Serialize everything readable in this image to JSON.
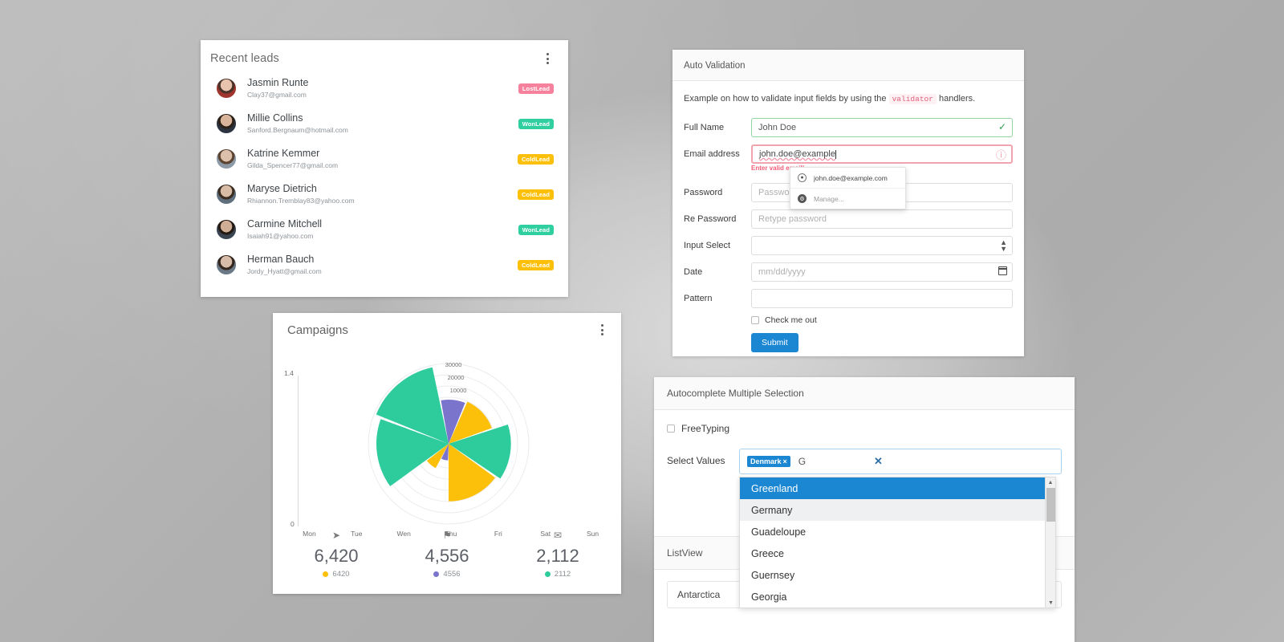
{
  "recent_leads": {
    "title": "Recent leads",
    "menu_icon": "kebab-menu-icon",
    "items": [
      {
        "name": "Jasmin Runte",
        "email": "Clay37@gmail.com",
        "badge": "LostLead",
        "badge_type": "lost"
      },
      {
        "name": "Millie Collins",
        "email": "Sanford.Bergnaum@hotmail.com",
        "badge": "WonLead",
        "badge_type": "won"
      },
      {
        "name": "Katrine Kemmer",
        "email": "Gilda_Spencer77@gmail.com",
        "badge": "ColdLead",
        "badge_type": "cold"
      },
      {
        "name": "Maryse Dietrich",
        "email": "Rhiannon.Tremblay83@yahoo.com",
        "badge": "ColdLead",
        "badge_type": "cold"
      },
      {
        "name": "Carmine Mitchell",
        "email": "Isaiah91@yahoo.com",
        "badge": "WonLead",
        "badge_type": "won"
      },
      {
        "name": "Herman Bauch",
        "email": "Jordy_Hyatt@gmail.com",
        "badge": "ColdLead",
        "badge_type": "cold"
      }
    ],
    "badge_colors": {
      "lost": "#f6819c",
      "won": "#30cfa0",
      "cold": "#fcc00a"
    }
  },
  "campaigns": {
    "title": "Campaigns",
    "menu_icon": "kebab-menu-icon",
    "stats": [
      {
        "icon": "send-icon",
        "value": "6,420",
        "legend": "6420",
        "color": "#fcc00a"
      },
      {
        "icon": "flag-icon",
        "value": "4,556",
        "legend": "4556",
        "color": "#7b74cd"
      },
      {
        "icon": "envelope-icon",
        "value": "2,112",
        "legend": "2112",
        "color": "#2ecb9c"
      }
    ]
  },
  "chart_data": {
    "type": "pie",
    "title": "Campaigns",
    "subtype": "polar-rose",
    "xlabel": "",
    "ylabel": "",
    "ylim": [
      0,
      1.4
    ],
    "y_tick_labels": [
      "1.4",
      "0"
    ],
    "x_tick_labels": [
      "Mon",
      "Tue",
      "Wen",
      "Thu",
      "Fri",
      "Sat",
      "Sun"
    ],
    "radial_tick_labels": [
      "30000",
      "20000",
      "10000"
    ],
    "radial_max": 30000,
    "grid": true,
    "legend_position": "bottom",
    "series": [
      {
        "name": "6420",
        "color": "#fcc00a",
        "values": [
          10300,
          21500,
          4200
        ]
      },
      {
        "name": "4556",
        "color": "#7b74cd",
        "values": [
          16500,
          6200
        ]
      },
      {
        "name": "2112",
        "color": "#2ecb9c",
        "values": [
          29200,
          23300
        ]
      }
    ],
    "wedges": [
      {
        "series": "2112",
        "color": "#2ecb9c",
        "start_deg": 292,
        "end_deg": 348,
        "value": 29200
      },
      {
        "series": "4556",
        "color": "#7b74cd",
        "start_deg": 350,
        "end_deg": 22,
        "value": 16500
      },
      {
        "series": "6420",
        "color": "#fcc00a",
        "start_deg": 24,
        "end_deg": 70,
        "value": 17200
      },
      {
        "series": "2112",
        "color": "#2ecb9c",
        "start_deg": 72,
        "end_deg": 124,
        "value": 23300
      },
      {
        "series": "6420",
        "color": "#fcc00a",
        "start_deg": 126,
        "end_deg": 180,
        "value": 21500
      },
      {
        "series": "4556",
        "color": "#7b74cd",
        "start_deg": 182,
        "end_deg": 206,
        "value": 6200
      },
      {
        "series": "6420",
        "color": "#fcc00a",
        "start_deg": 208,
        "end_deg": 232,
        "value": 10300
      },
      {
        "series": "2112",
        "color": "#2ecb9c",
        "start_deg": 234,
        "end_deg": 290,
        "value": 27000
      }
    ]
  },
  "auto_validation": {
    "title": "Auto Validation",
    "description_before": "Example on how to validate input fields by using the ",
    "description_code": "validator",
    "description_after": " handlers.",
    "fields": {
      "full_name": {
        "label": "Full Name",
        "value": "John Doe",
        "state": "valid",
        "icon": "check-icon"
      },
      "email": {
        "label": "Email address",
        "value": "john.doe@example",
        "state": "invalid",
        "icon": "error-circle-icon",
        "error": "Enter valid email!"
      },
      "password": {
        "label": "Password",
        "placeholder": "Password"
      },
      "re_password": {
        "label": "Re Password",
        "placeholder": "Retype password"
      },
      "input_select": {
        "label": "Input Select",
        "value": "",
        "icon": "spinner-arrows-icon"
      },
      "date": {
        "label": "Date",
        "placeholder": "mm/dd/yyyy",
        "icon": "calendar-icon"
      },
      "pattern": {
        "label": "Pattern",
        "value": ""
      }
    },
    "autofill": {
      "suggestion": "john.doe@example.com",
      "manage": "Manage...",
      "suggestion_icon": "person-circle-icon",
      "manage_icon": "gear-icon"
    },
    "checkbox_label": "Check me out",
    "submit_label": "Submit",
    "submit_color": "#1b87d2"
  },
  "autocomplete": {
    "title": "Autocomplete Multiple Selection",
    "freetyping_label": "FreeTyping",
    "select_values_label": "Select Values",
    "chips": [
      {
        "label": "Denmark",
        "remove_icon": "close-x-icon"
      }
    ],
    "typed_text": "G",
    "clear_icon": "clear-x-icon",
    "options": [
      {
        "label": "Greenland",
        "selected": true
      },
      {
        "label": "Germany",
        "selected": false
      },
      {
        "label": "Guadeloupe",
        "selected": false
      },
      {
        "label": "Greece",
        "selected": false
      },
      {
        "label": "Guernsey",
        "selected": false
      },
      {
        "label": "Georgia",
        "selected": false
      }
    ],
    "scrollbar": {
      "up_icon": "scroll-up-arrow-icon",
      "down_icon": "scroll-down-arrow-icon"
    }
  },
  "listview": {
    "title": "ListView",
    "items": [
      {
        "label": "Antarctica"
      }
    ]
  }
}
